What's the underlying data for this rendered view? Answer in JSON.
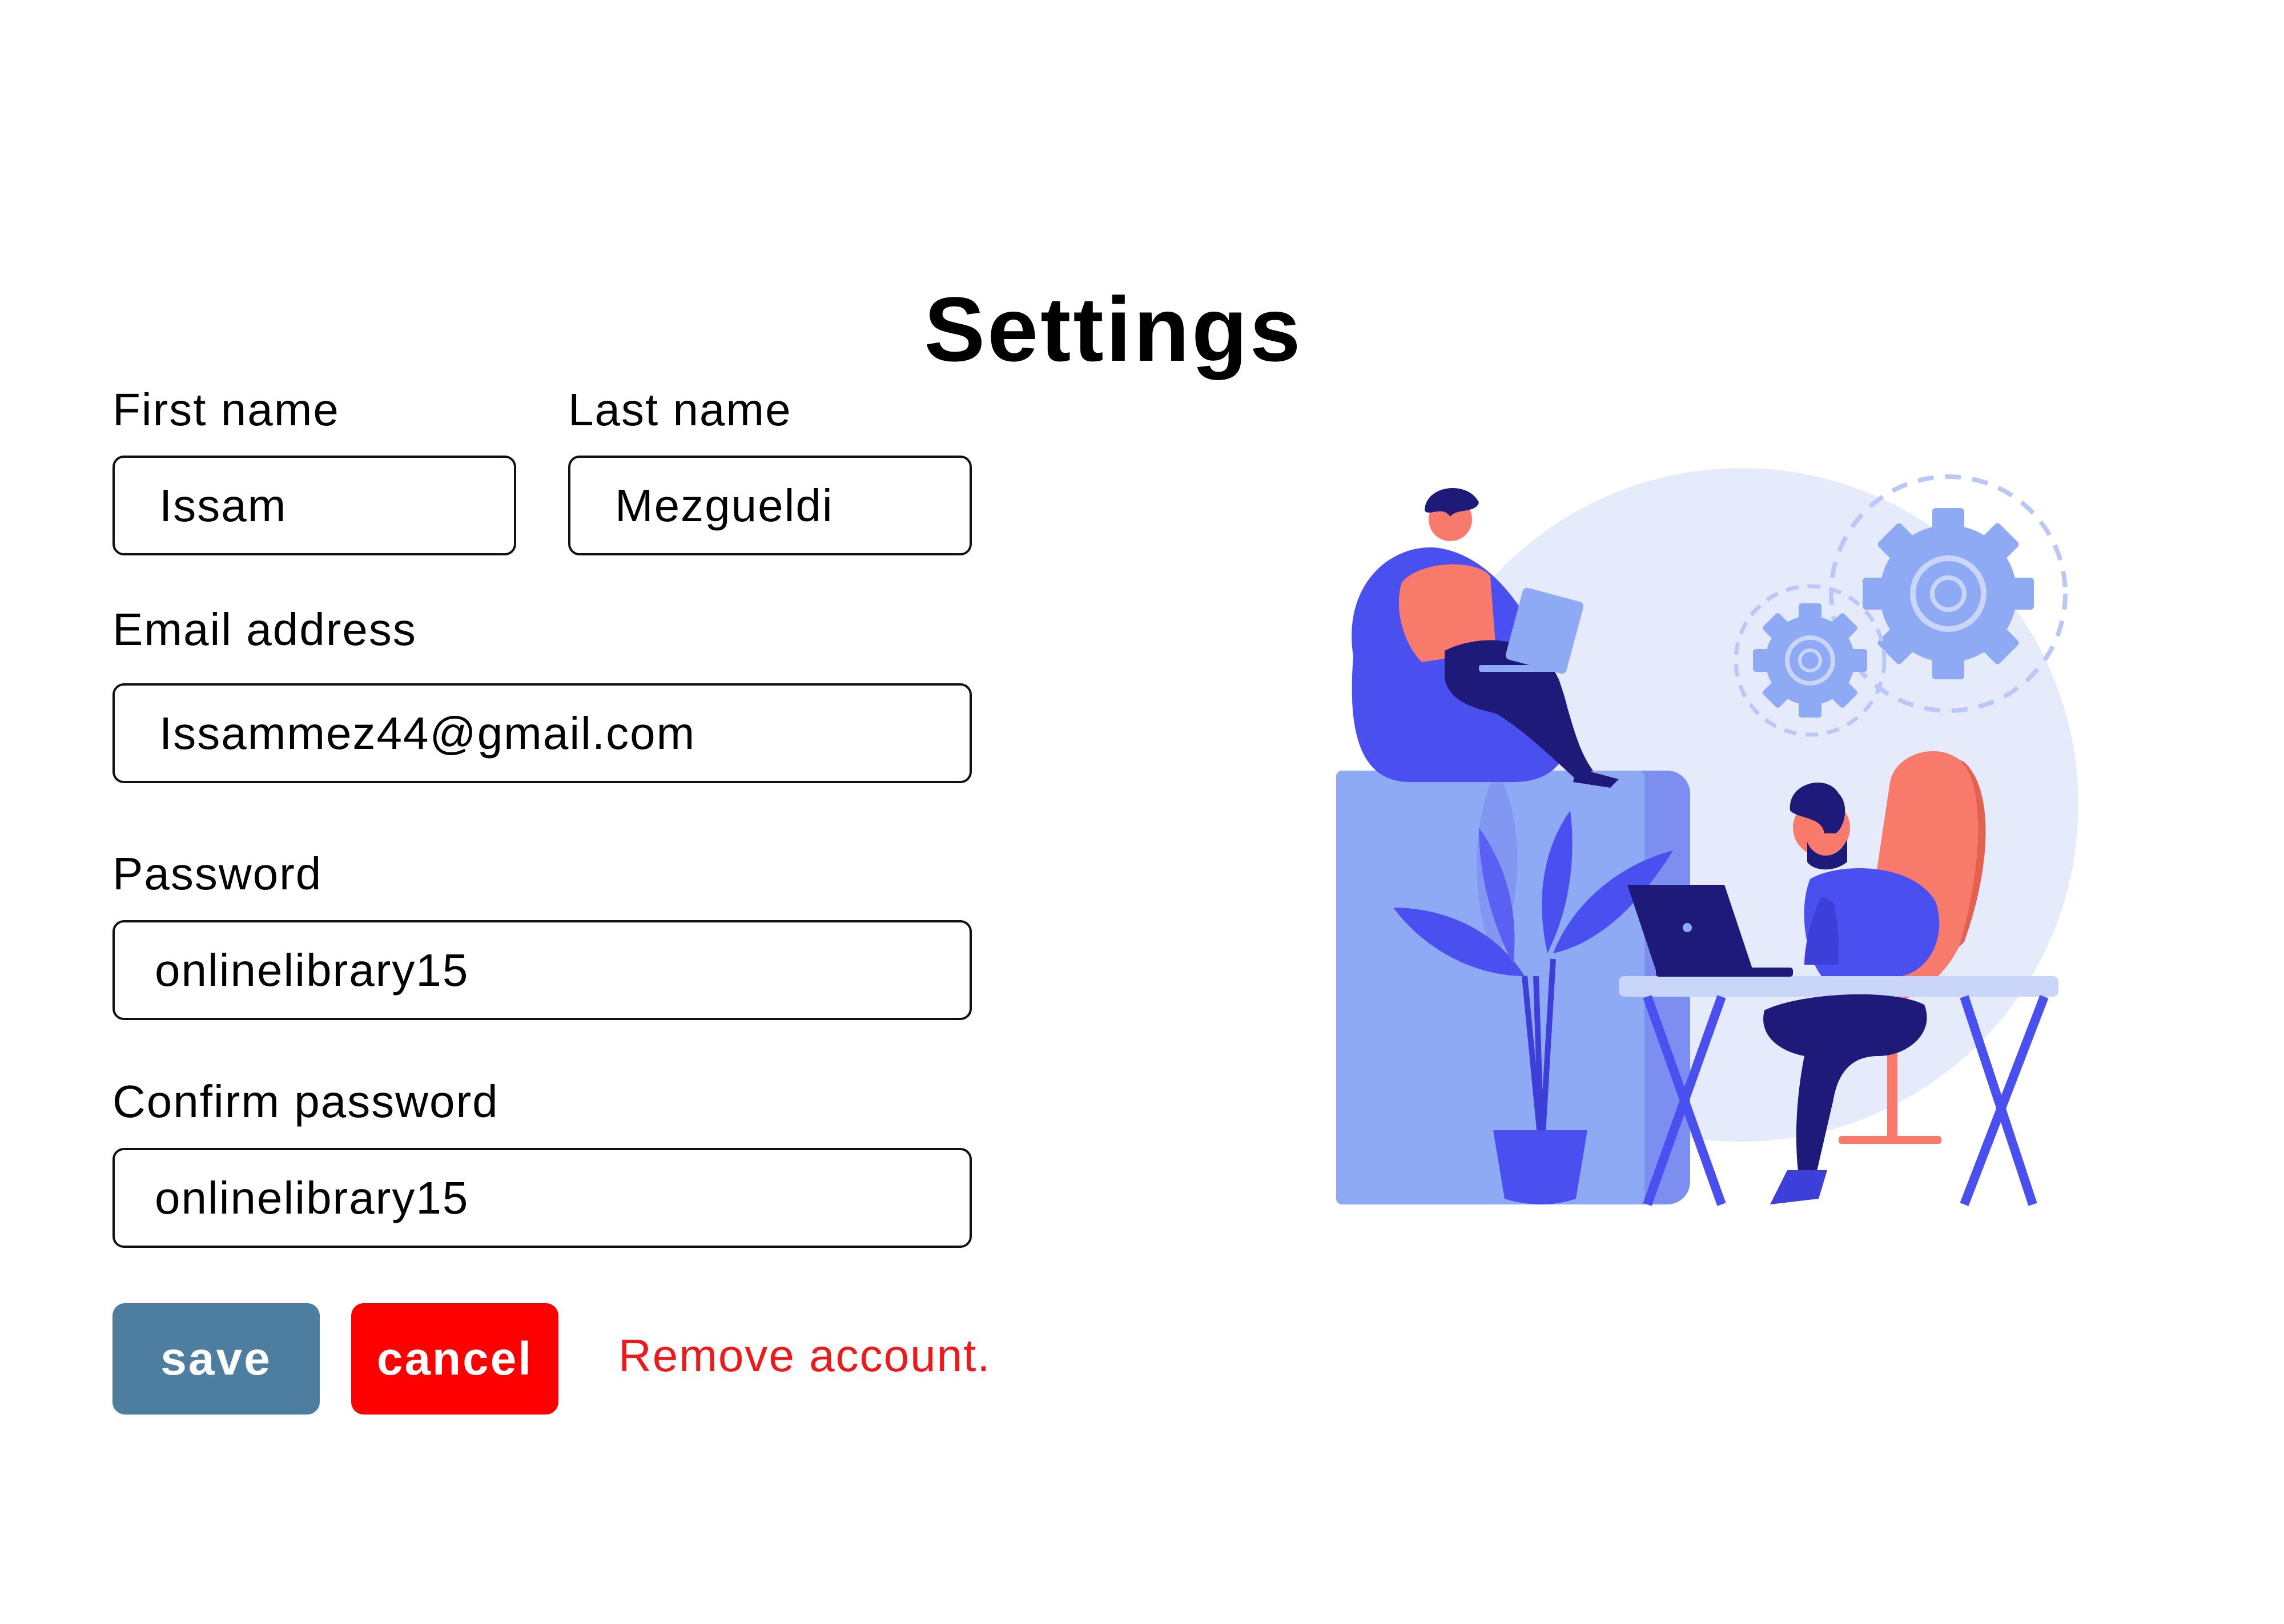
{
  "page": {
    "title": "Settings"
  },
  "form": {
    "first_name": {
      "label": "First name",
      "value": "Issam"
    },
    "last_name": {
      "label": "Last name",
      "value": "Mezgueldi"
    },
    "email": {
      "label": "Email address",
      "value": "Issammez44@gmail.com"
    },
    "password": {
      "label": "Password",
      "value": "onlinelibrary15"
    },
    "confirm_password": {
      "label": "Confirm password",
      "value": "onlinelibrary15"
    }
  },
  "actions": {
    "save_label": "save",
    "cancel_label": "cancel",
    "remove_account_label": "Remove account."
  },
  "colors": {
    "save_button": "#4D7EA0",
    "cancel_button": "#FF0000",
    "remove_link": "#F01818",
    "illustration_primary": "#4A4FF0",
    "illustration_light": "#8FAAF5",
    "illustration_bg_circle": "#E6EBFC",
    "illustration_accent": "#F87A6A",
    "illustration_dark": "#1E1A7A"
  },
  "illustration": {
    "icon": "people-working-with-gears-illustration"
  }
}
